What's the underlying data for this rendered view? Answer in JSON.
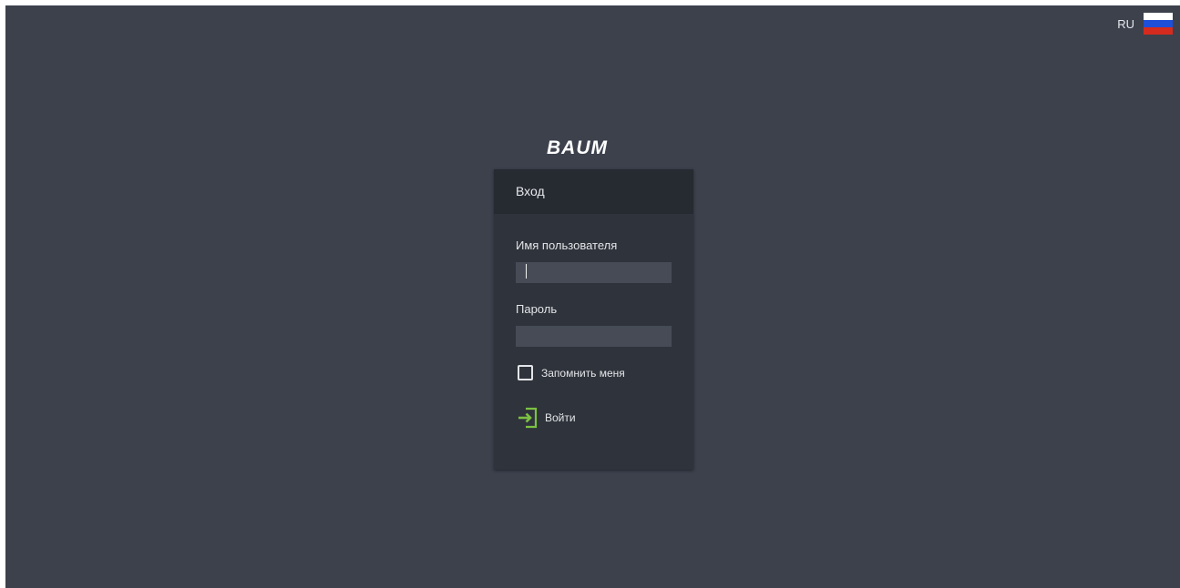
{
  "language": {
    "code": "RU",
    "flag_icon": "russia-flag-icon",
    "flag_colors": [
      "#ffffff",
      "#1d4fd8",
      "#d52b1e"
    ]
  },
  "brand": {
    "logo_text": "BAUM"
  },
  "login": {
    "title": "Вход",
    "username_label": "Имя пользователя",
    "username_value": "",
    "password_label": "Пароль",
    "password_value": "",
    "remember_label": "Запомнить меня",
    "remember_checked": false,
    "submit_label": "Войти",
    "submit_icon": "sign-in-icon",
    "accent_color": "#7cc243"
  },
  "colors": {
    "background": "#3c414c",
    "card": "#2f333b",
    "card_header": "#262a31",
    "input": "#464b55"
  }
}
